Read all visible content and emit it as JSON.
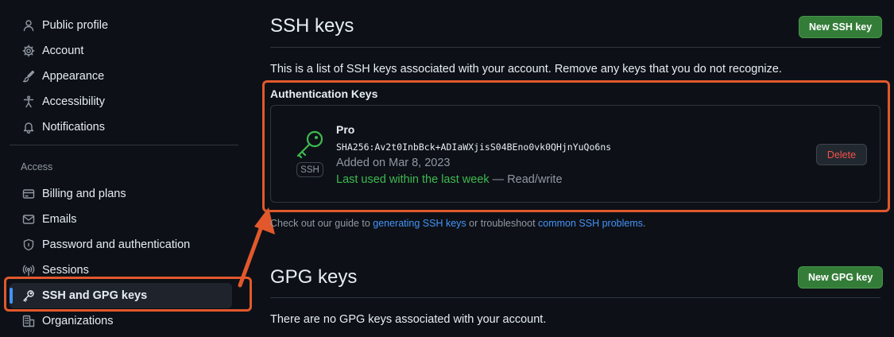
{
  "sidebar": {
    "items": [
      {
        "label": "Public profile",
        "icon": "person-icon"
      },
      {
        "label": "Account",
        "icon": "gear-icon"
      },
      {
        "label": "Appearance",
        "icon": "paintbrush-icon"
      },
      {
        "label": "Accessibility",
        "icon": "accessibility-icon"
      },
      {
        "label": "Notifications",
        "icon": "bell-icon"
      }
    ],
    "access_heading": "Access",
    "access_items": [
      {
        "label": "Billing and plans",
        "icon": "credit-card-icon"
      },
      {
        "label": "Emails",
        "icon": "mail-icon"
      },
      {
        "label": "Password and authentication",
        "icon": "shield-lock-icon"
      },
      {
        "label": "Sessions",
        "icon": "broadcast-icon"
      },
      {
        "label": "SSH and GPG keys",
        "icon": "key-icon",
        "active": true
      },
      {
        "label": "Organizations",
        "icon": "organization-icon"
      }
    ]
  },
  "ssh": {
    "title": "SSH keys",
    "new_button": "New SSH key",
    "description": "This is a list of SSH keys associated with your account. Remove any keys that you do not recognize.",
    "auth_heading": "Authentication Keys",
    "key": {
      "name": "Pro",
      "fingerprint": "SHA256:Av2t0InbBck+ADIaWXjisS04BEno0vk0QHjnYuQo6ns",
      "added": "Added on Mar 8, 2023",
      "last_used": "Last used within the last week",
      "access": " — Read/write",
      "badge": "SSH",
      "delete_label": "Delete"
    },
    "guide_prefix": "Check out our guide to ",
    "guide_link1": "generating SSH keys",
    "guide_middle": " or troubleshoot ",
    "guide_link2": "common SSH problems",
    "guide_suffix": "."
  },
  "gpg": {
    "title": "GPG keys",
    "new_button": "New GPG key",
    "empty_text": "There are no GPG keys associated with your account."
  },
  "colors": {
    "accent_green": "#347d39",
    "link_blue": "#4493f8",
    "annotation_orange": "#e2582c",
    "last_used_green": "#3fb950",
    "danger_red": "#f85149"
  }
}
